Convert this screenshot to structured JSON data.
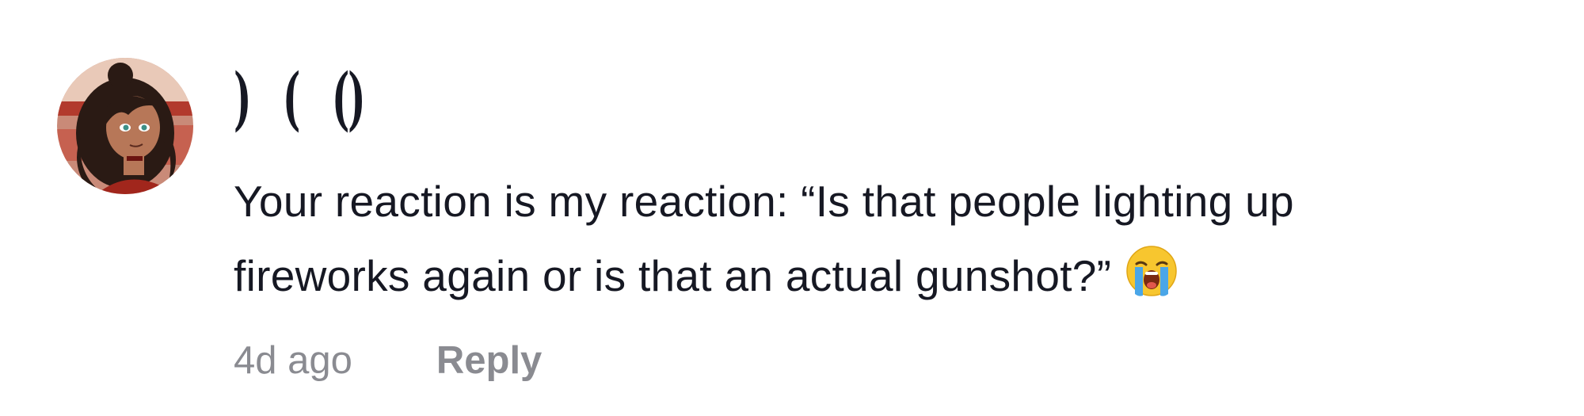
{
  "comment": {
    "avatar_icon": "user-avatar-image",
    "username": ")(’()",
    "username_glyphs": [
      ")",
      "(",
      "()"
    ],
    "text_line_1": "Your reaction is my reaction: “Is that people lighting up",
    "text_line_2": "fireworks again or is that an actual gunshot?”",
    "emoji_icon": "loudly-crying-face-emoji",
    "timestamp": "4d ago",
    "reply_label": "Reply"
  },
  "colors": {
    "text_primary": "#161823",
    "text_secondary": "#8a8b91",
    "background": "#ffffff"
  }
}
